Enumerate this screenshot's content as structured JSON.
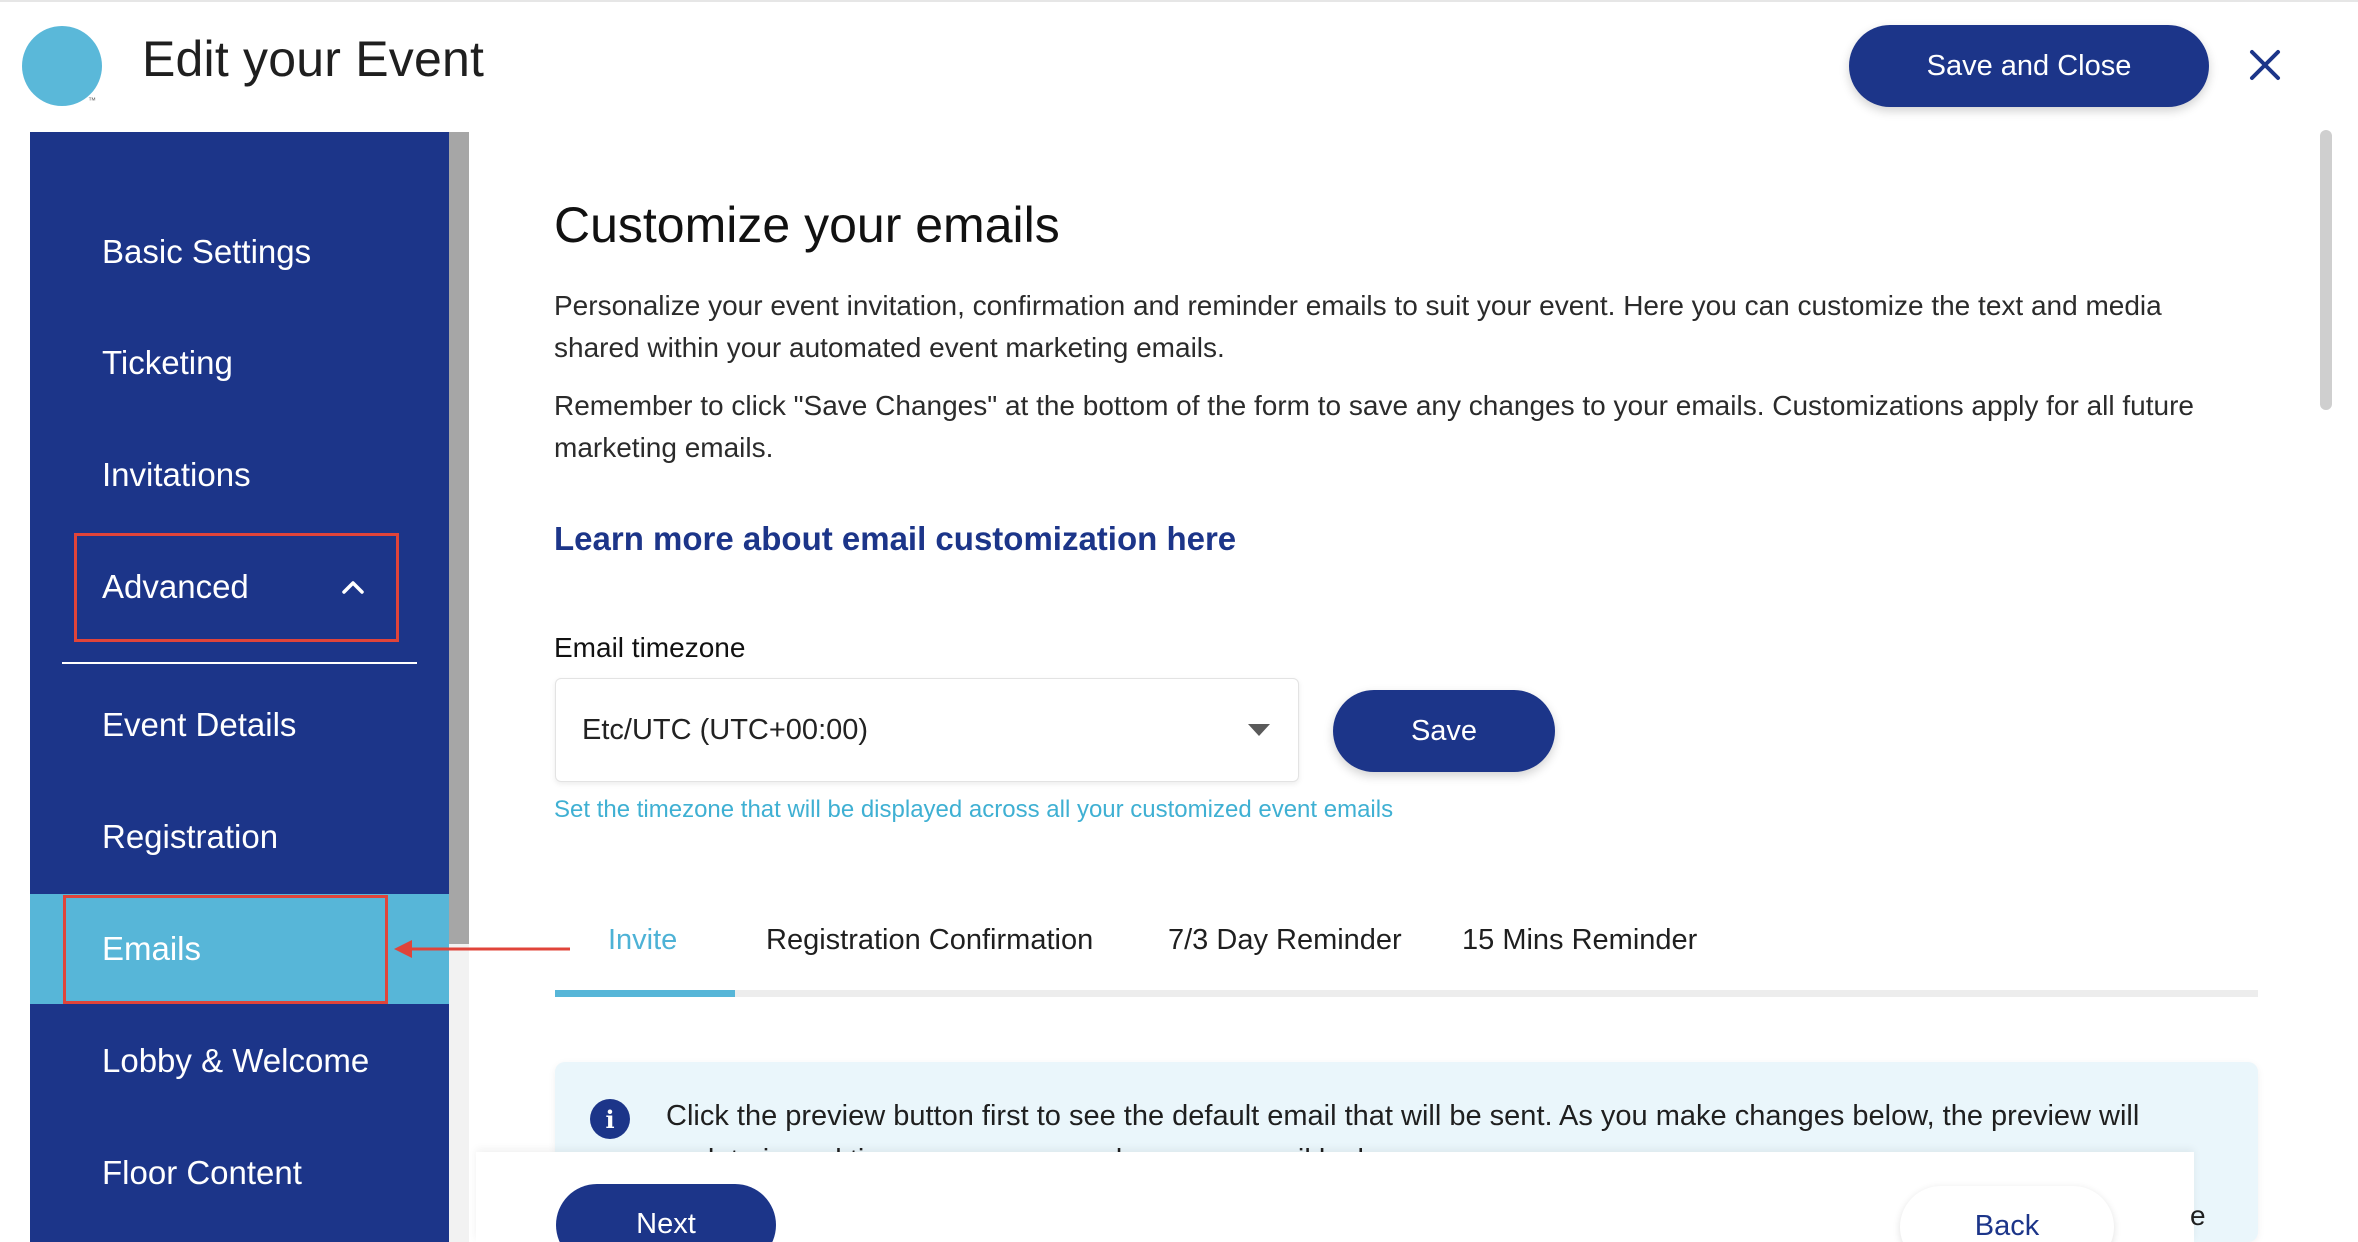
{
  "header": {
    "title": "Edit your Event",
    "logo_tm": "™",
    "save_close_label": "Save and Close",
    "close_icon": "close-icon"
  },
  "sidebar": {
    "items": [
      {
        "label": "Basic Settings"
      },
      {
        "label": "Ticketing"
      },
      {
        "label": "Invitations"
      },
      {
        "label": "Advanced",
        "expanded": true
      },
      {
        "label": "Event Details"
      },
      {
        "label": "Registration"
      },
      {
        "label": "Emails",
        "active": true
      },
      {
        "label": "Lobby & Welcome"
      },
      {
        "label": "Floor Content"
      }
    ]
  },
  "main": {
    "title": "Customize your emails",
    "paragraph1": "Personalize your event invitation, confirmation and reminder emails to suit your event. Here you can customize the text and media shared within your automated event marketing emails.",
    "paragraph2": "Remember to click \"Save Changes\" at the bottom of the form to save any changes to your emails. Customizations apply for all future marketing emails.",
    "learn_more": "Learn more about email customization here",
    "timezone": {
      "label": "Email timezone",
      "value": "Etc/UTC (UTC+00:00)",
      "save_label": "Save",
      "hint": "Set the timezone that will be displayed across all your customized event emails"
    },
    "tabs": [
      {
        "label": "Invite",
        "active": true
      },
      {
        "label": "Registration Confirmation"
      },
      {
        "label": "7/3 Day Reminder"
      },
      {
        "label": "15 Mins Reminder"
      }
    ],
    "info_text": "Click the preview button first to see the default email that will be sent. As you make changes below, the preview will update in real time so you can see how your email looks."
  },
  "footer": {
    "next_label": "Next",
    "back_label": "Back",
    "stray_text": "e"
  },
  "colors": {
    "brand_navy": "#1c3589",
    "accent_blue": "#57b6d8",
    "highlight_red": "#e0443a"
  }
}
